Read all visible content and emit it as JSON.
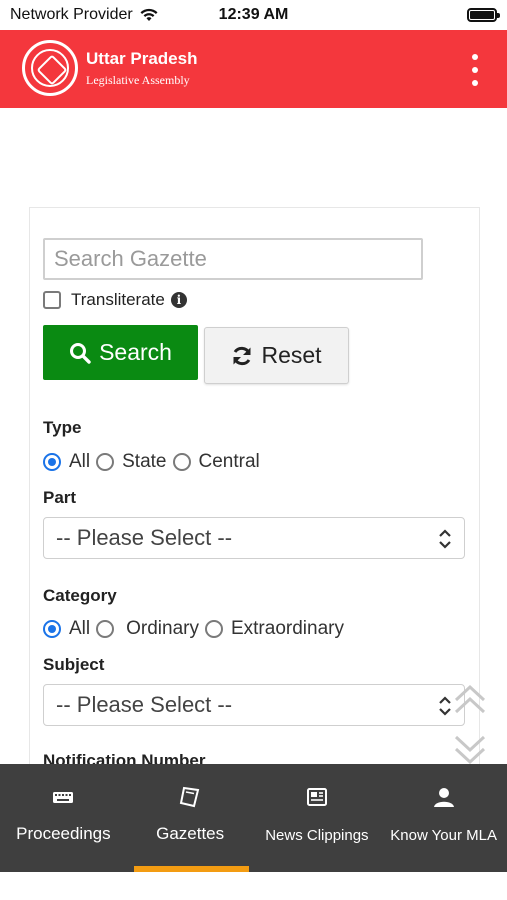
{
  "status_bar": {
    "carrier": "Network Provider",
    "time": "12:39 AM",
    "wifi_icon": "wifi-icon",
    "battery_icon": "battery-icon"
  },
  "header": {
    "title": "Uttar Pradesh",
    "subtitle": "Legislative Assembly",
    "logo_icon": "emblem-logo",
    "menu_icon": "kebab-menu-icon",
    "background_color": "#f4373d"
  },
  "search_form": {
    "search_placeholder": "Search Gazette",
    "search_value": "",
    "transliterate_label": "Transliterate",
    "transliterate_checked": false,
    "search_button_label": "Search",
    "reset_button_label": "Reset",
    "search_button_color": "#0a8a12",
    "type": {
      "label": "Type",
      "options": [
        "All",
        "State",
        "Central"
      ],
      "selected": "All"
    },
    "part": {
      "label": "Part",
      "selected": "-- Please Select --"
    },
    "category": {
      "label": "Category",
      "options": [
        "All",
        "Ordinary",
        "Extraordinary"
      ],
      "selected": "All"
    },
    "subject": {
      "label": "Subject",
      "selected": "-- Please Select --"
    },
    "notification_number": {
      "label": "Notification Number"
    }
  },
  "bottom_nav": {
    "items": [
      {
        "label": "Proceedings",
        "icon": "keyboard-icon"
      },
      {
        "label": "Gazettes",
        "icon": "document-icon"
      },
      {
        "label": "News Clippings",
        "icon": "newspaper-icon"
      },
      {
        "label": "Know Your MLA",
        "icon": "person-icon"
      }
    ],
    "active": "Gazettes",
    "indicator_color": "#f39c12"
  }
}
